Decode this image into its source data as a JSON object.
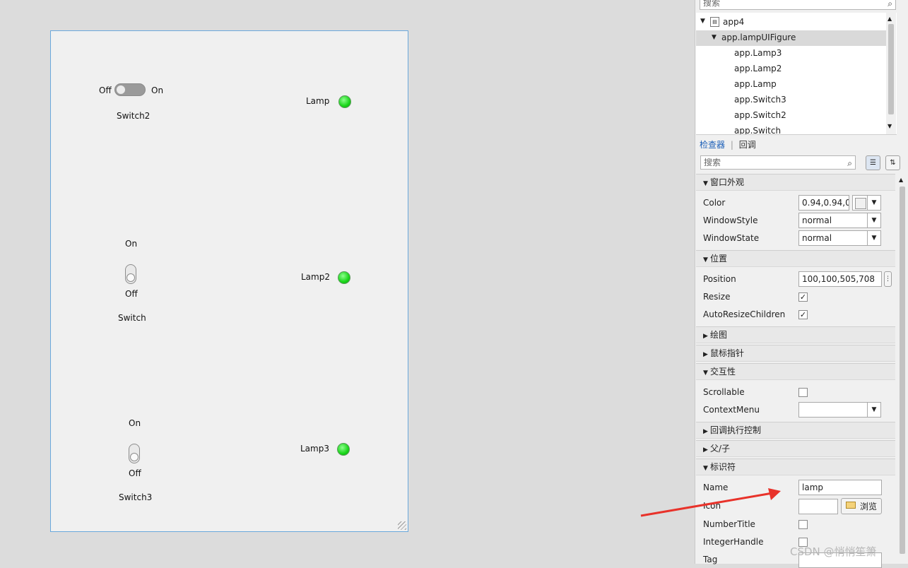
{
  "figure": {
    "switch2": {
      "off_label": "Off",
      "on_label": "On",
      "name": "Switch2"
    },
    "switch": {
      "on_label": "On",
      "off_label": "Off",
      "name": "Switch"
    },
    "switch3": {
      "on_label": "On",
      "off_label": "Off",
      "name": "Switch3"
    },
    "lamps": [
      {
        "label": "Lamp",
        "color": "#1ad41a"
      },
      {
        "label": "Lamp2",
        "color": "#1ad41a"
      },
      {
        "label": "Lamp3",
        "color": "#1ad41a"
      }
    ]
  },
  "browser": {
    "search_placeholder": "搜索",
    "tree": {
      "root": "app4",
      "selected": "app.lampUIFigure",
      "children": [
        "app.Lamp3",
        "app.Lamp2",
        "app.Lamp",
        "app.Switch3",
        "app.Switch2",
        "app.Switch"
      ]
    }
  },
  "inspector": {
    "tabs": {
      "active": "检查器",
      "other": "回调"
    },
    "search_placeholder": "搜索",
    "sections": {
      "window_appearance": "窗口外观",
      "position": "位置",
      "plotting": "绘图",
      "mouse_pointer": "鼠标指针",
      "interactivity": "交互性",
      "callback_control": "回调执行控制",
      "parent_child": "父/子",
      "identifiers": "标识符"
    },
    "props": {
      "color": {
        "label": "Color",
        "value": "0.94,0.94,0",
        "swatch": "#f0f0f0"
      },
      "window_style": {
        "label": "WindowStyle",
        "value": "normal"
      },
      "window_state": {
        "label": "WindowState",
        "value": "normal"
      },
      "position": {
        "label": "Position",
        "value": "100,100,505,708"
      },
      "resize": {
        "label": "Resize",
        "checked": true
      },
      "auto_resize_children": {
        "label": "AutoResizeChildren",
        "checked": true
      },
      "scrollable": {
        "label": "Scrollable",
        "checked": false
      },
      "context_menu": {
        "label": "ContextMenu",
        "value": ""
      },
      "name": {
        "label": "Name",
        "value": "lamp"
      },
      "icon": {
        "label": "Icon",
        "value": "",
        "browse_label": "浏览"
      },
      "number_title": {
        "label": "NumberTitle",
        "checked": false
      },
      "integer_handle": {
        "label": "IntegerHandle",
        "checked": false
      },
      "tag": {
        "label": "Tag"
      }
    }
  },
  "annotation": {
    "arrow_color": "#e8322a"
  },
  "watermark": "CSDN @悄悄笙箫"
}
